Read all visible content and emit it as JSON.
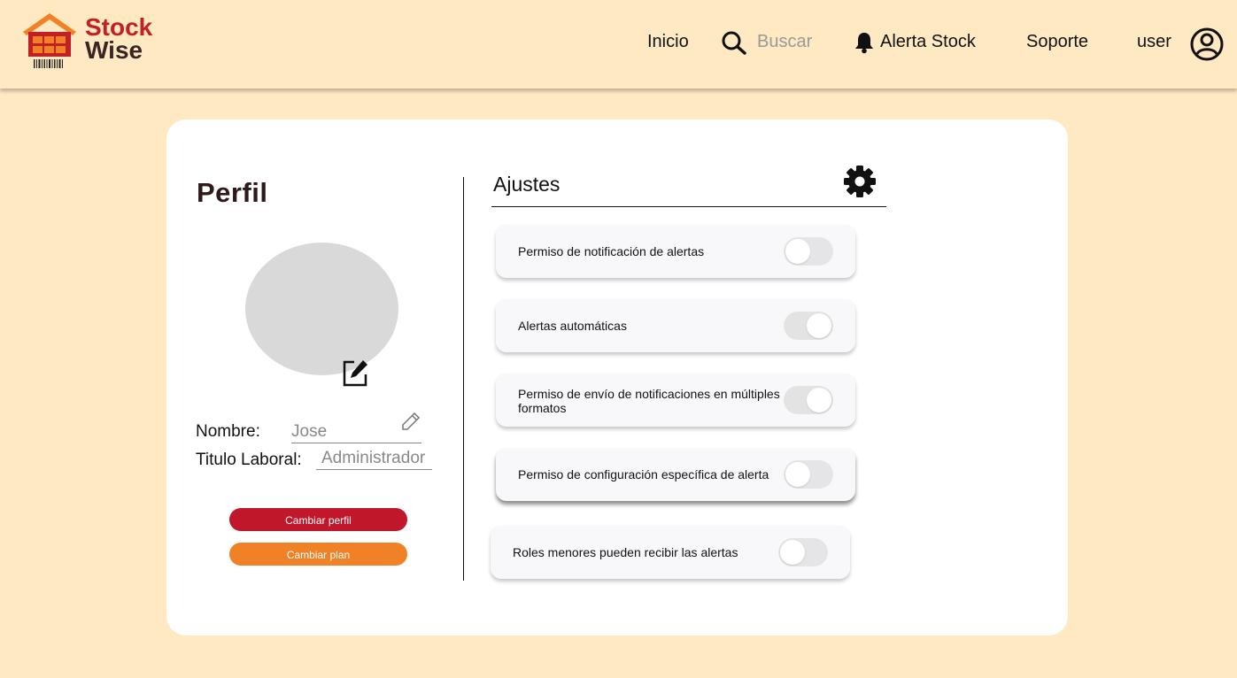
{
  "brand": {
    "line1": "Stock",
    "line2": "Wise"
  },
  "nav": {
    "inicio": "Inicio",
    "search_placeholder": "Buscar",
    "alerta": "Alerta Stock",
    "soporte": "Soporte",
    "user": "user"
  },
  "perfil": {
    "title": "Perfil",
    "nombre_label": "Nombre:",
    "nombre_value": "Jose",
    "titulo_label": "Titulo Laboral:",
    "titulo_value": "Administrador",
    "cambiar_perfil": "Cambiar perfil",
    "cambiar_plan": "Cambiar plan"
  },
  "ajustes": {
    "title": "Ajustes",
    "items": [
      {
        "label": "Permiso de notificación de alertas",
        "enabled": false
      },
      {
        "label": "Alertas automáticas",
        "enabled": true
      },
      {
        "label": "Permiso de envío de notificaciones en múltiples formatos",
        "enabled": true
      },
      {
        "label": "Permiso de configuración específica de alerta",
        "enabled": false
      },
      {
        "label": "Roles menores pueden recibir las alertas",
        "enabled": false
      }
    ]
  },
  "colors": {
    "background": "#fee9c3",
    "brand_red": "#c32026",
    "primary_button": "#c0182a",
    "secondary_button": "#f08127"
  }
}
